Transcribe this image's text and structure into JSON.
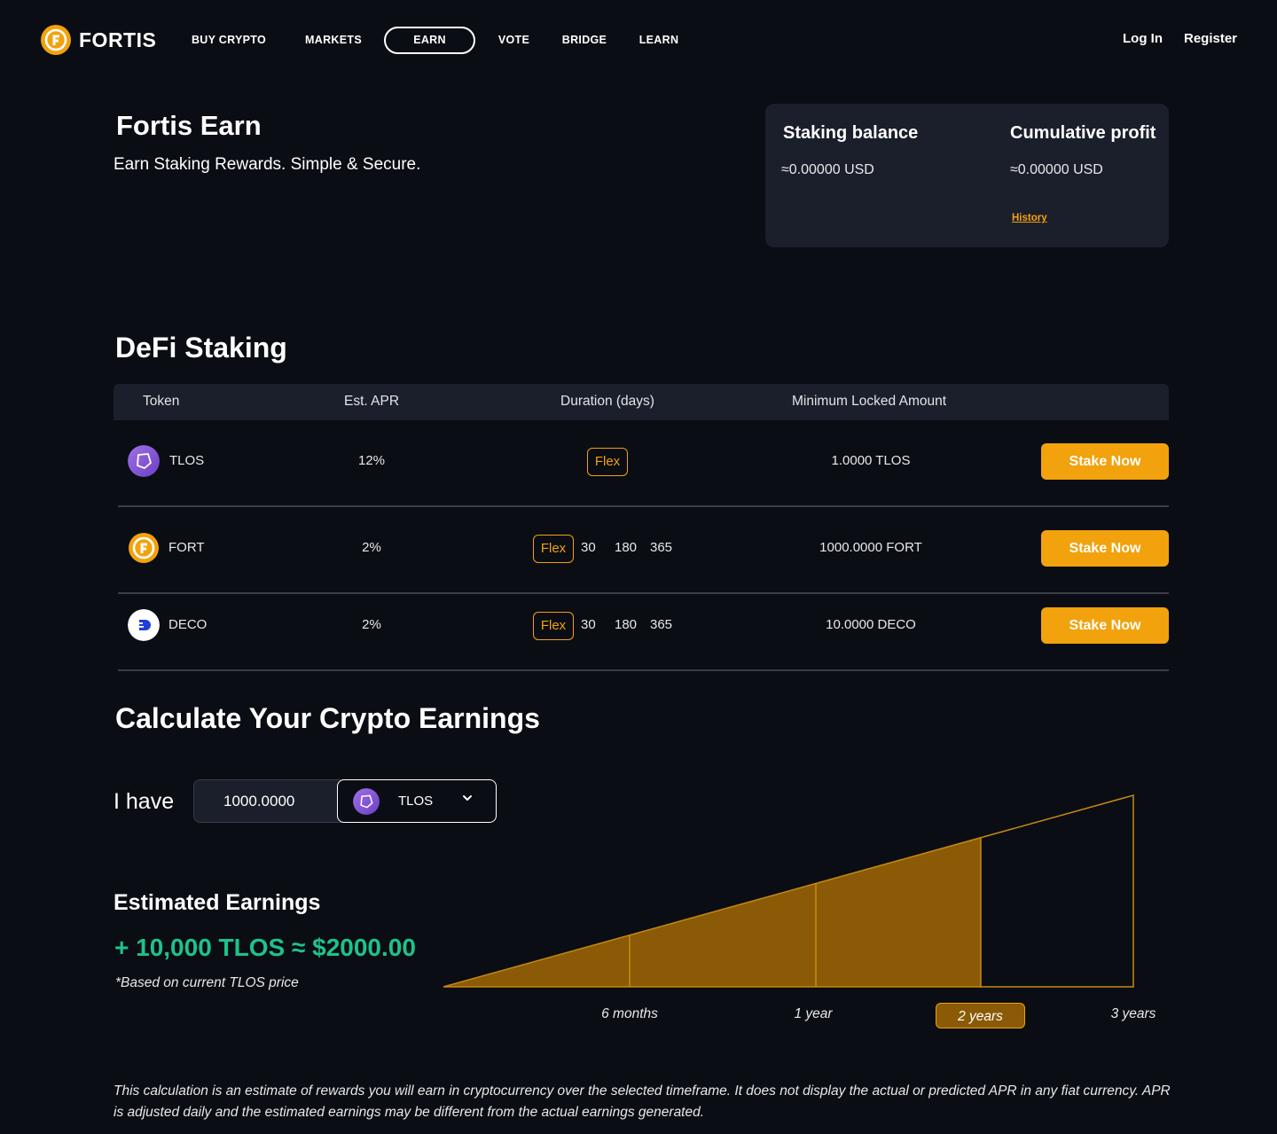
{
  "nav": {
    "brand": "FORTIS",
    "items": [
      "BUY CRYPTO",
      "MARKETS",
      "EARN",
      "VOTE",
      "BRIDGE",
      "LEARN"
    ],
    "active": "EARN",
    "login": "Log In",
    "register": "Register"
  },
  "hero": {
    "title": "Fortis Earn",
    "subtitle": "Earn Staking Rewards. Simple & Secure."
  },
  "balance": {
    "staking_label": "Staking balance",
    "staking_value": "≈0.00000 USD",
    "profit_label": "Cumulative profit",
    "profit_value": "≈0.00000 USD",
    "history_link": "History"
  },
  "defi": {
    "title": "DeFi Staking",
    "headers": [
      "Token",
      "Est. APR",
      "Duration (days)",
      "Minimum Locked Amount"
    ],
    "rows": [
      {
        "token": "TLOS",
        "apr": "12%",
        "durations": [
          "Flex"
        ],
        "min": "1.0000 TLOS",
        "action": "Stake Now"
      },
      {
        "token": "FORT",
        "apr": "2%",
        "durations": [
          "Flex",
          "30",
          "180",
          "365"
        ],
        "min": "1000.0000 FORT",
        "action": "Stake Now"
      },
      {
        "token": "DECO",
        "apr": "2%",
        "durations": [
          "Flex",
          "30",
          "180",
          "365"
        ],
        "min": "10.0000 DECO",
        "action": "Stake Now"
      }
    ]
  },
  "calculator": {
    "title": "Calculate Your Crypto Earnings",
    "i_have": "I have",
    "amount": "1000.0000",
    "token": "TLOS",
    "estimated_title": "Estimated Earnings",
    "estimated_value": "+ 10,000 TLOS ≈ $2000.00",
    "note": "*Based on current TLOS price",
    "timeframes": [
      "6 months",
      "1 year",
      "2 years",
      "3 years"
    ],
    "selected_timeframe": "2 years",
    "disclaimer": "This calculation is an estimate of rewards you will earn in cryptocurrency over the selected timeframe. It does not display the actual or predicted APR in any fiat currency. APR is adjusted daily and the estimated earnings may be different from the actual earnings generated."
  },
  "colors": {
    "background": "#0a0d14",
    "card": "#1b1f2b",
    "accent": "#f2a20c",
    "chart_fill": "#8a5a06",
    "earnings": "#1ec28b",
    "tlos": "#8a5ad6",
    "deco": "#1f3fd6"
  },
  "icons": {
    "logo": "fortis-coin-icon",
    "tlos": "tlos-token-icon",
    "fort": "fortis-coin-icon",
    "deco": "deco-token-icon",
    "chevron": "chevron-down-icon"
  }
}
